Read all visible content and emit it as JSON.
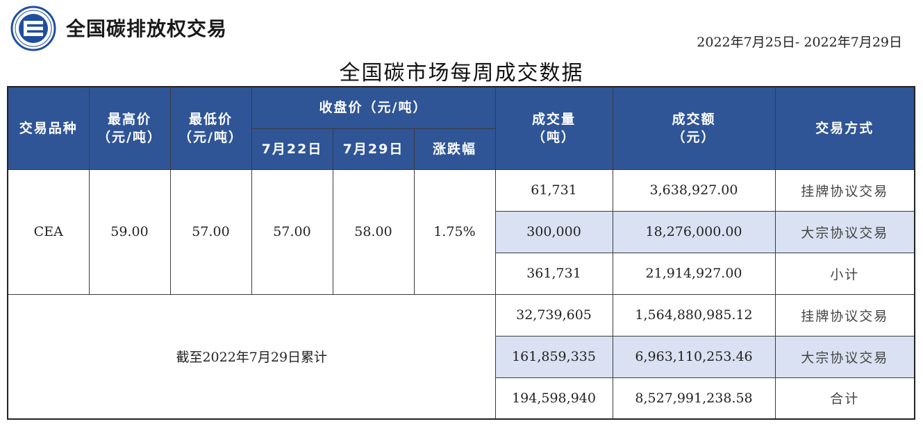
{
  "brand": {
    "name": "全国碳排放权交易"
  },
  "date_range": "2022年7月25日- 2022年7月29日",
  "report_title": "全国碳市场每周成交数据",
  "headers": {
    "product": "交易品种",
    "high": "最高价",
    "low": "最低价",
    "unit_price": "（元/吨）",
    "close": "收盘价（元/吨）",
    "close_prev": "7月22日",
    "close_curr": "7月29日",
    "change": "涨跌幅",
    "volume": "成交量",
    "volume_unit": "（吨）",
    "amount": "成交额",
    "amount_unit": "（元）",
    "method": "交易方式"
  },
  "weekly": {
    "product": "CEA",
    "high": "59.00",
    "low": "57.00",
    "close_prev": "57.00",
    "close_curr": "58.00",
    "change": "1.75%",
    "rows": [
      {
        "volume": "61,731",
        "amount": "3,638,927.00",
        "method": "挂牌协议交易"
      },
      {
        "volume": "300,000",
        "amount": "18,276,000.00",
        "method": "大宗协议交易"
      },
      {
        "volume": "361,731",
        "amount": "21,914,927.00",
        "method": "小计"
      }
    ]
  },
  "cumulative": {
    "label": "截至2022年7月29日累计",
    "rows": [
      {
        "volume": "32,739,605",
        "amount": "1,564,880,985.12",
        "method": "挂牌协议交易"
      },
      {
        "volume": "161,859,335",
        "amount": "6,963,110,253.46",
        "method": "大宗协议交易"
      },
      {
        "volume": "194,598,940",
        "amount": "8,527,991,238.58",
        "method": "合计"
      }
    ]
  },
  "colors": {
    "header_bg": "#2f5597",
    "row_shade": "#d9e1f2",
    "logo": "#1f4e9e"
  }
}
